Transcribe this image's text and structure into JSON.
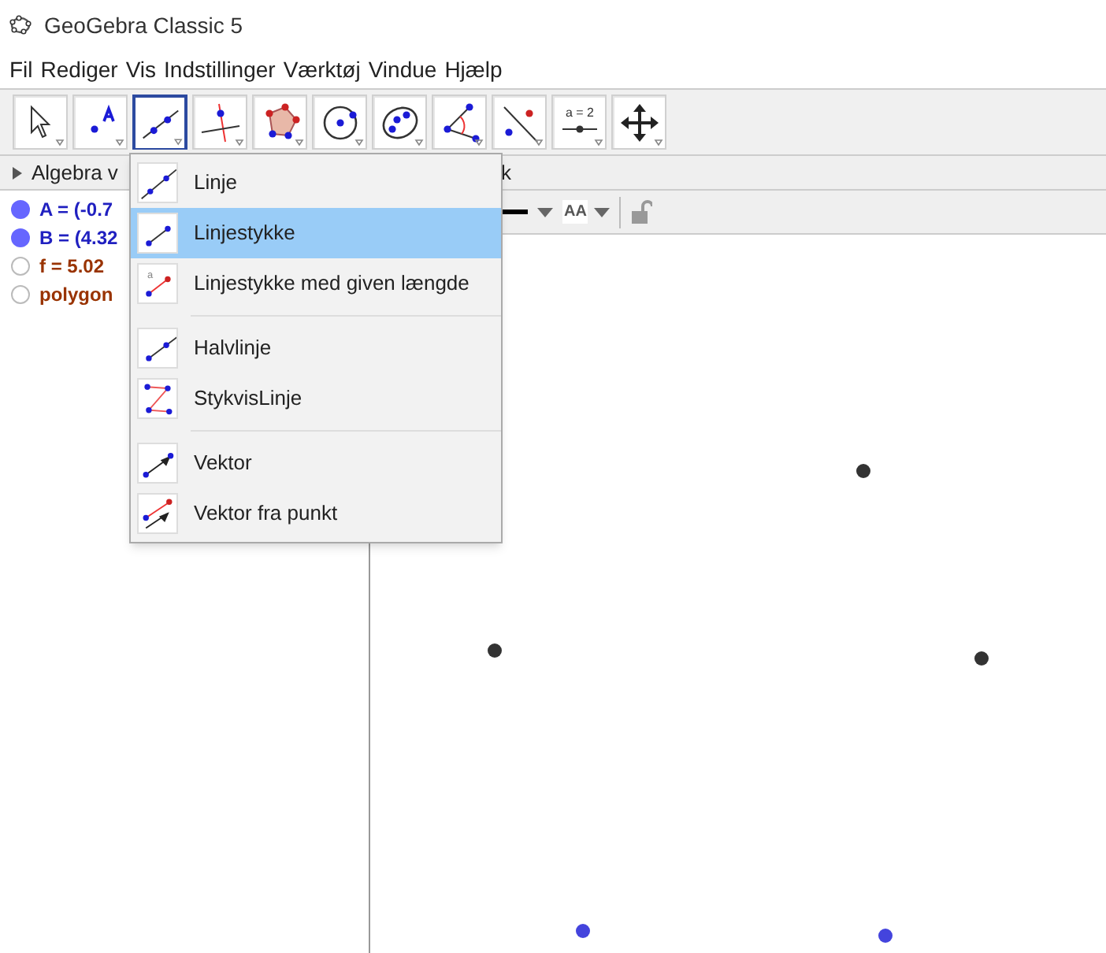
{
  "window": {
    "title": "GeoGebra Classic 5"
  },
  "menu": [
    "Fil",
    "Rediger",
    "Vis",
    "Indstillinger",
    "Værktøj",
    "Vindue",
    "Hjælp"
  ],
  "toolbar": [
    {
      "selected": false
    },
    {
      "selected": false
    },
    {
      "selected": true
    },
    {
      "selected": false
    },
    {
      "selected": false
    },
    {
      "selected": false
    },
    {
      "selected": false
    },
    {
      "selected": false
    },
    {
      "selected": false
    },
    {
      "label": "a = 2",
      "selected": false
    },
    {
      "selected": false
    }
  ],
  "algebra": {
    "title": "Algebra v",
    "items": [
      {
        "text": "A = (-0.7",
        "visible": true,
        "color": "#2020c0"
      },
      {
        "text": "B = (4.32",
        "visible": true,
        "color": "#2020c0"
      },
      {
        "text": "f = 5.02",
        "visible": false,
        "color": "#993300"
      },
      {
        "text": "polygon",
        "visible": false,
        "color": "#993300"
      }
    ]
  },
  "graphics": {
    "title": "k",
    "font_button": "AA",
    "points": [
      {
        "color": "#333333"
      },
      {
        "color": "#333333"
      },
      {
        "color": "#333333"
      },
      {
        "color": "#4444dd"
      },
      {
        "color": "#4444dd"
      }
    ]
  },
  "dropdown": [
    [
      {
        "label": "Linje",
        "selected": false
      },
      {
        "label": "Linjestykke",
        "selected": true
      },
      {
        "label": "Linjestykke med given længde",
        "icon_text": "a",
        "selected": false
      }
    ],
    [
      {
        "label": "Halvlinje",
        "selected": false
      },
      {
        "label": "StykvisLinje",
        "selected": false
      }
    ],
    [
      {
        "label": "Vektor",
        "selected": false
      },
      {
        "label": "Vektor fra punkt",
        "selected": false
      }
    ]
  ]
}
